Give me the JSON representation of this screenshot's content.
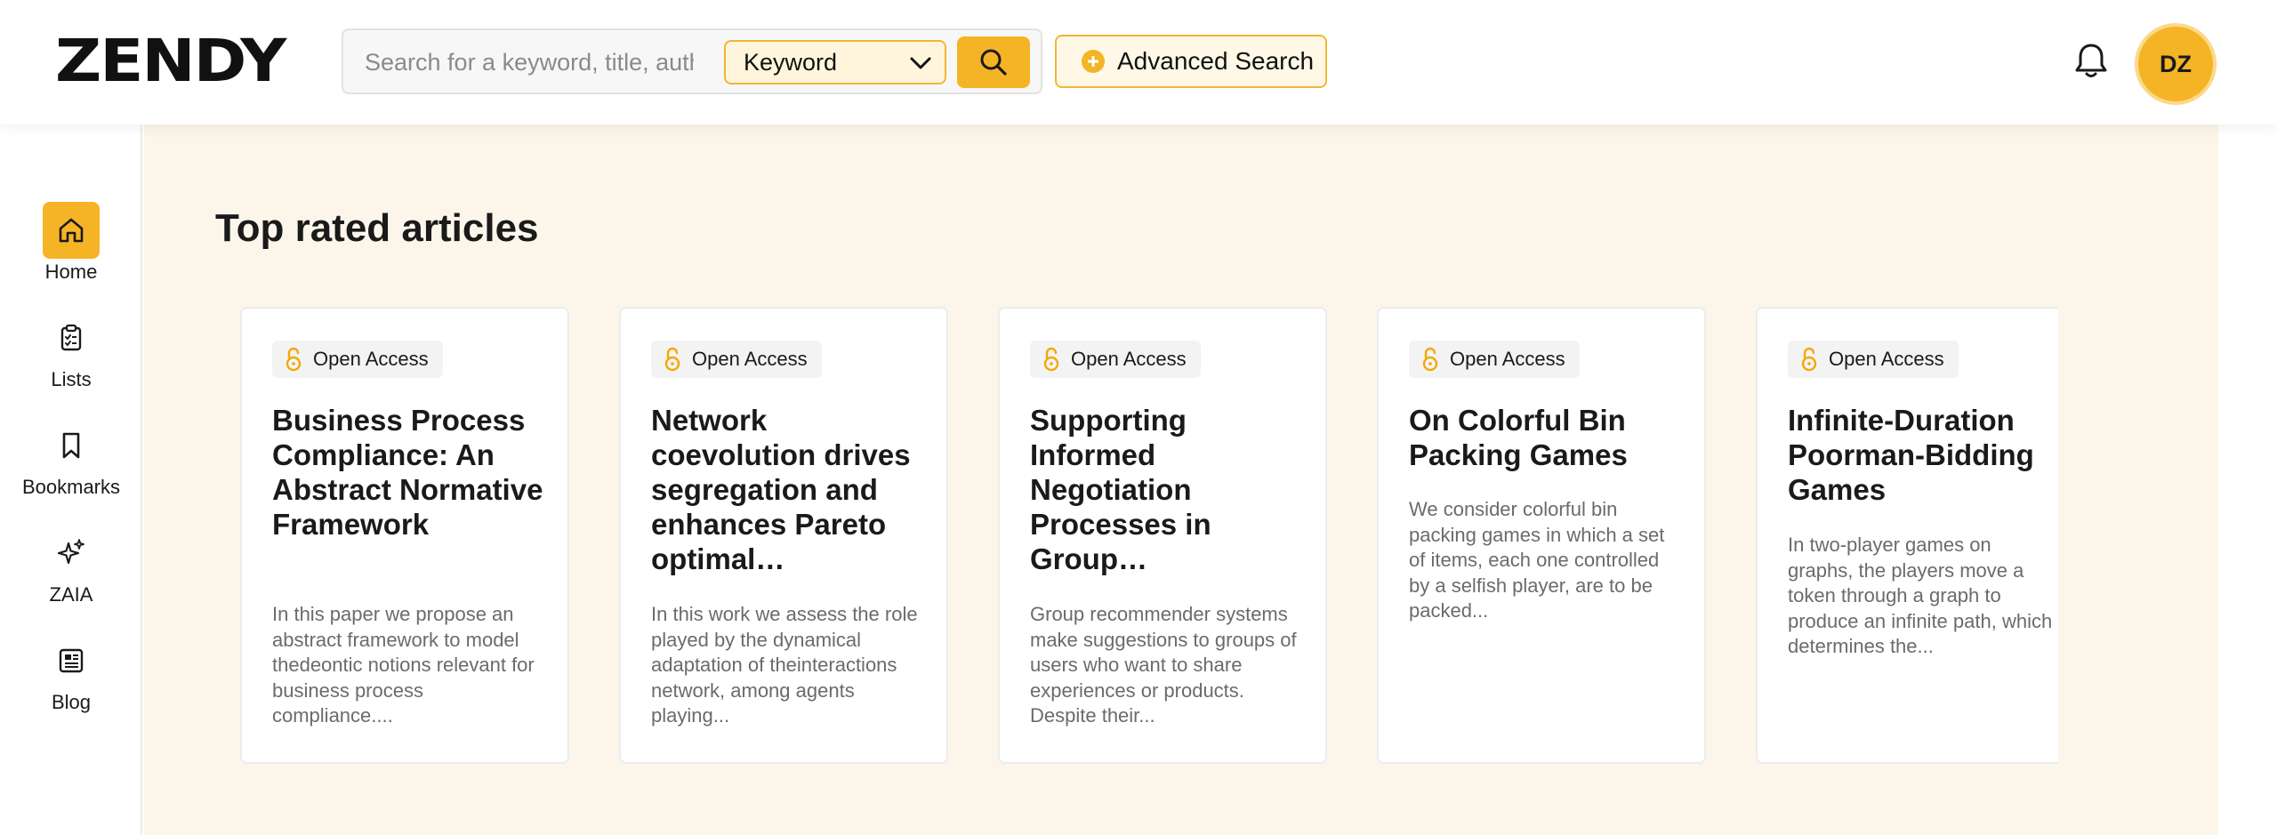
{
  "header": {
    "logo_text": "ZENDY",
    "search_placeholder": "Search for a keyword, title, author",
    "search_mode": "Keyword",
    "advanced_search_label": "Advanced Search",
    "avatar_initials": "DZ"
  },
  "sidebar": {
    "items": [
      {
        "label": "Home",
        "icon": "home-icon",
        "active": true
      },
      {
        "label": "Lists",
        "icon": "clipboard-icon",
        "active": false
      },
      {
        "label": "Bookmarks",
        "icon": "bookmark-icon",
        "active": false
      },
      {
        "label": "ZAIA",
        "icon": "sparkle-icon",
        "active": false
      },
      {
        "label": "Blog",
        "icon": "newspaper-icon",
        "active": false
      }
    ]
  },
  "main": {
    "section_title": "Top rated articles",
    "cards": [
      {
        "badge": "Open Access",
        "title": "Business Process Compliance: An Abstract Normative Framework",
        "abstract": "In this paper we propose an abstract framework to model thedeontic notions relevant for business process compliance...."
      },
      {
        "badge": "Open Access",
        "title": "Network coevolution drives segregation and enhances Pareto optimal…",
        "abstract": "In this work we assess the role played by the dynamical adaptation of theinteractions network, among agents playing..."
      },
      {
        "badge": "Open Access",
        "title": "Supporting Informed Negotiation Processes in Group…",
        "abstract": "Group recommender systems make suggestions to groups of users who want to share experiences or products. Despite their..."
      },
      {
        "badge": "Open Access",
        "title": "On Colorful Bin Packing Games",
        "abstract": "We consider colorful bin packing games in which a set of items, each one controlled by a selfish player, are to be packed..."
      },
      {
        "badge": "Open Access",
        "title": "Infinite-Duration Poorman-Bidding Games",
        "abstract": "In two-player games on graphs, the players move a token through a graph to produce an infinite path, which determines the..."
      }
    ]
  },
  "colors": {
    "accent": "#f5b425",
    "main_background": "#fcf6ea"
  }
}
